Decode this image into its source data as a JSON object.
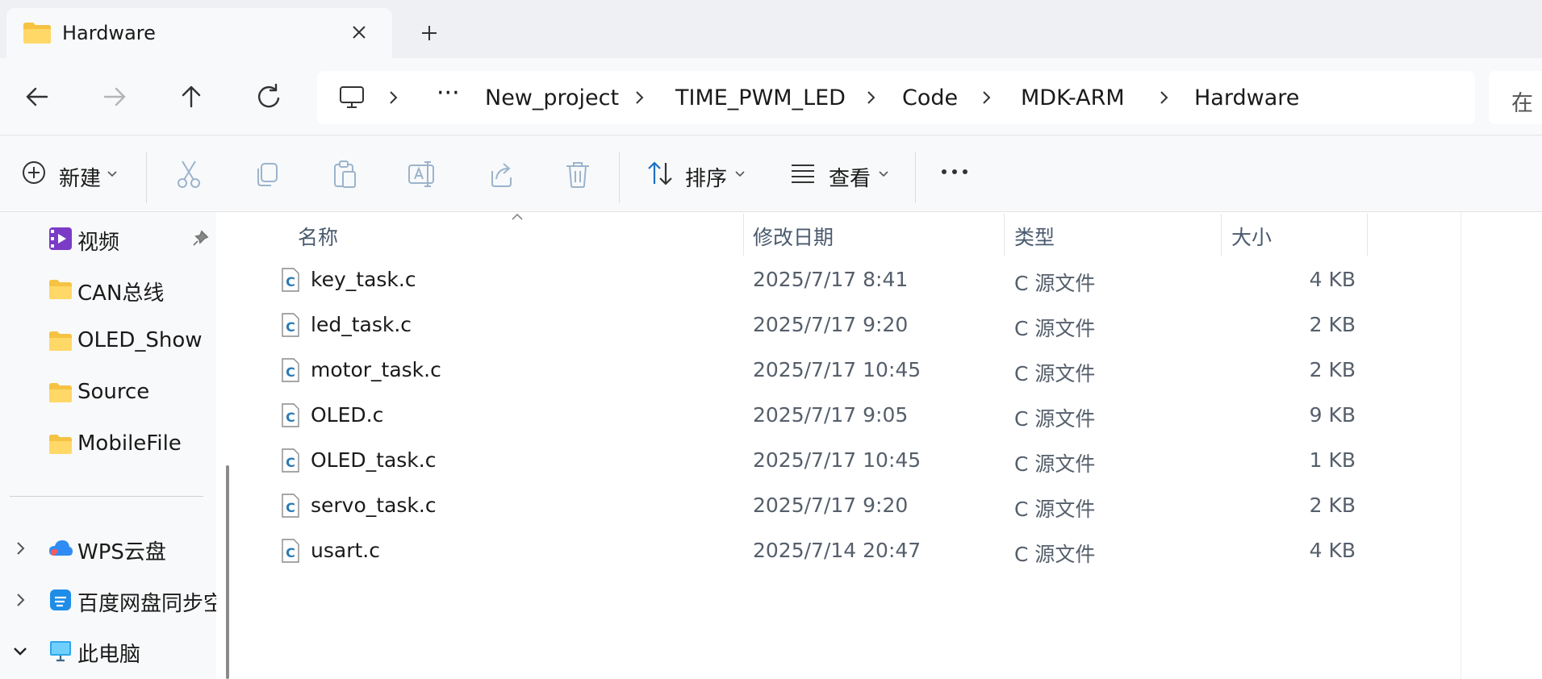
{
  "tab": {
    "title": "Hardware",
    "folder_icon": "folder-icon",
    "close_icon": "close-icon",
    "new_tab_icon": "plus-icon"
  },
  "nav": {
    "back_icon": "arrow-left-icon",
    "forward_icon": "arrow-right-icon",
    "up_icon": "arrow-up-icon",
    "refresh_icon": "refresh-icon"
  },
  "address": {
    "computer_icon": "monitor-icon",
    "overflow": "···",
    "crumbs": [
      "New_project",
      "TIME_PWM_LED",
      "Code",
      "MDK-ARM",
      "Hardware"
    ]
  },
  "search": {
    "placeholder": "在"
  },
  "toolbar": {
    "new_label": "新建",
    "sort_label": "排序",
    "view_label": "查看",
    "more_label": "···"
  },
  "sidebar": {
    "items": [
      {
        "label": "视频",
        "icon": "video-icon"
      },
      {
        "label": "CAN总线",
        "icon": "folder-icon"
      },
      {
        "label": "OLED_Show",
        "icon": "folder-icon"
      },
      {
        "label": "Source",
        "icon": "folder-icon"
      },
      {
        "label": "MobileFile",
        "icon": "folder-icon"
      },
      {
        "label": "WPS云盘",
        "icon": "cloud-icon"
      },
      {
        "label": "百度网盘同步空间",
        "icon": "baidu-icon"
      },
      {
        "label": "此电脑",
        "icon": "pc-icon"
      }
    ]
  },
  "columns": {
    "name": "名称",
    "modified": "修改日期",
    "type": "类型",
    "size": "大小"
  },
  "files": [
    {
      "name": "key_task.c",
      "modified": "2025/7/17 8:41",
      "type": "C 源文件",
      "size": "4 KB"
    },
    {
      "name": "led_task.c",
      "modified": "2025/7/17 9:20",
      "type": "C 源文件",
      "size": "2 KB"
    },
    {
      "name": "motor_task.c",
      "modified": "2025/7/17 10:45",
      "type": "C 源文件",
      "size": "2 KB"
    },
    {
      "name": "OLED.c",
      "modified": "2025/7/17 9:05",
      "type": "C 源文件",
      "size": "9 KB"
    },
    {
      "name": "OLED_task.c",
      "modified": "2025/7/17 10:45",
      "type": "C 源文件",
      "size": "1 KB"
    },
    {
      "name": "servo_task.c",
      "modified": "2025/7/17 9:20",
      "type": "C 源文件",
      "size": "2 KB"
    },
    {
      "name": "usart.c",
      "modified": "2025/7/14 20:47",
      "type": "C 源文件",
      "size": "4 KB"
    }
  ],
  "colors": {
    "folder": "#f5c242",
    "accent": "#1b6fc6",
    "c_file": "#2b7ab5"
  }
}
